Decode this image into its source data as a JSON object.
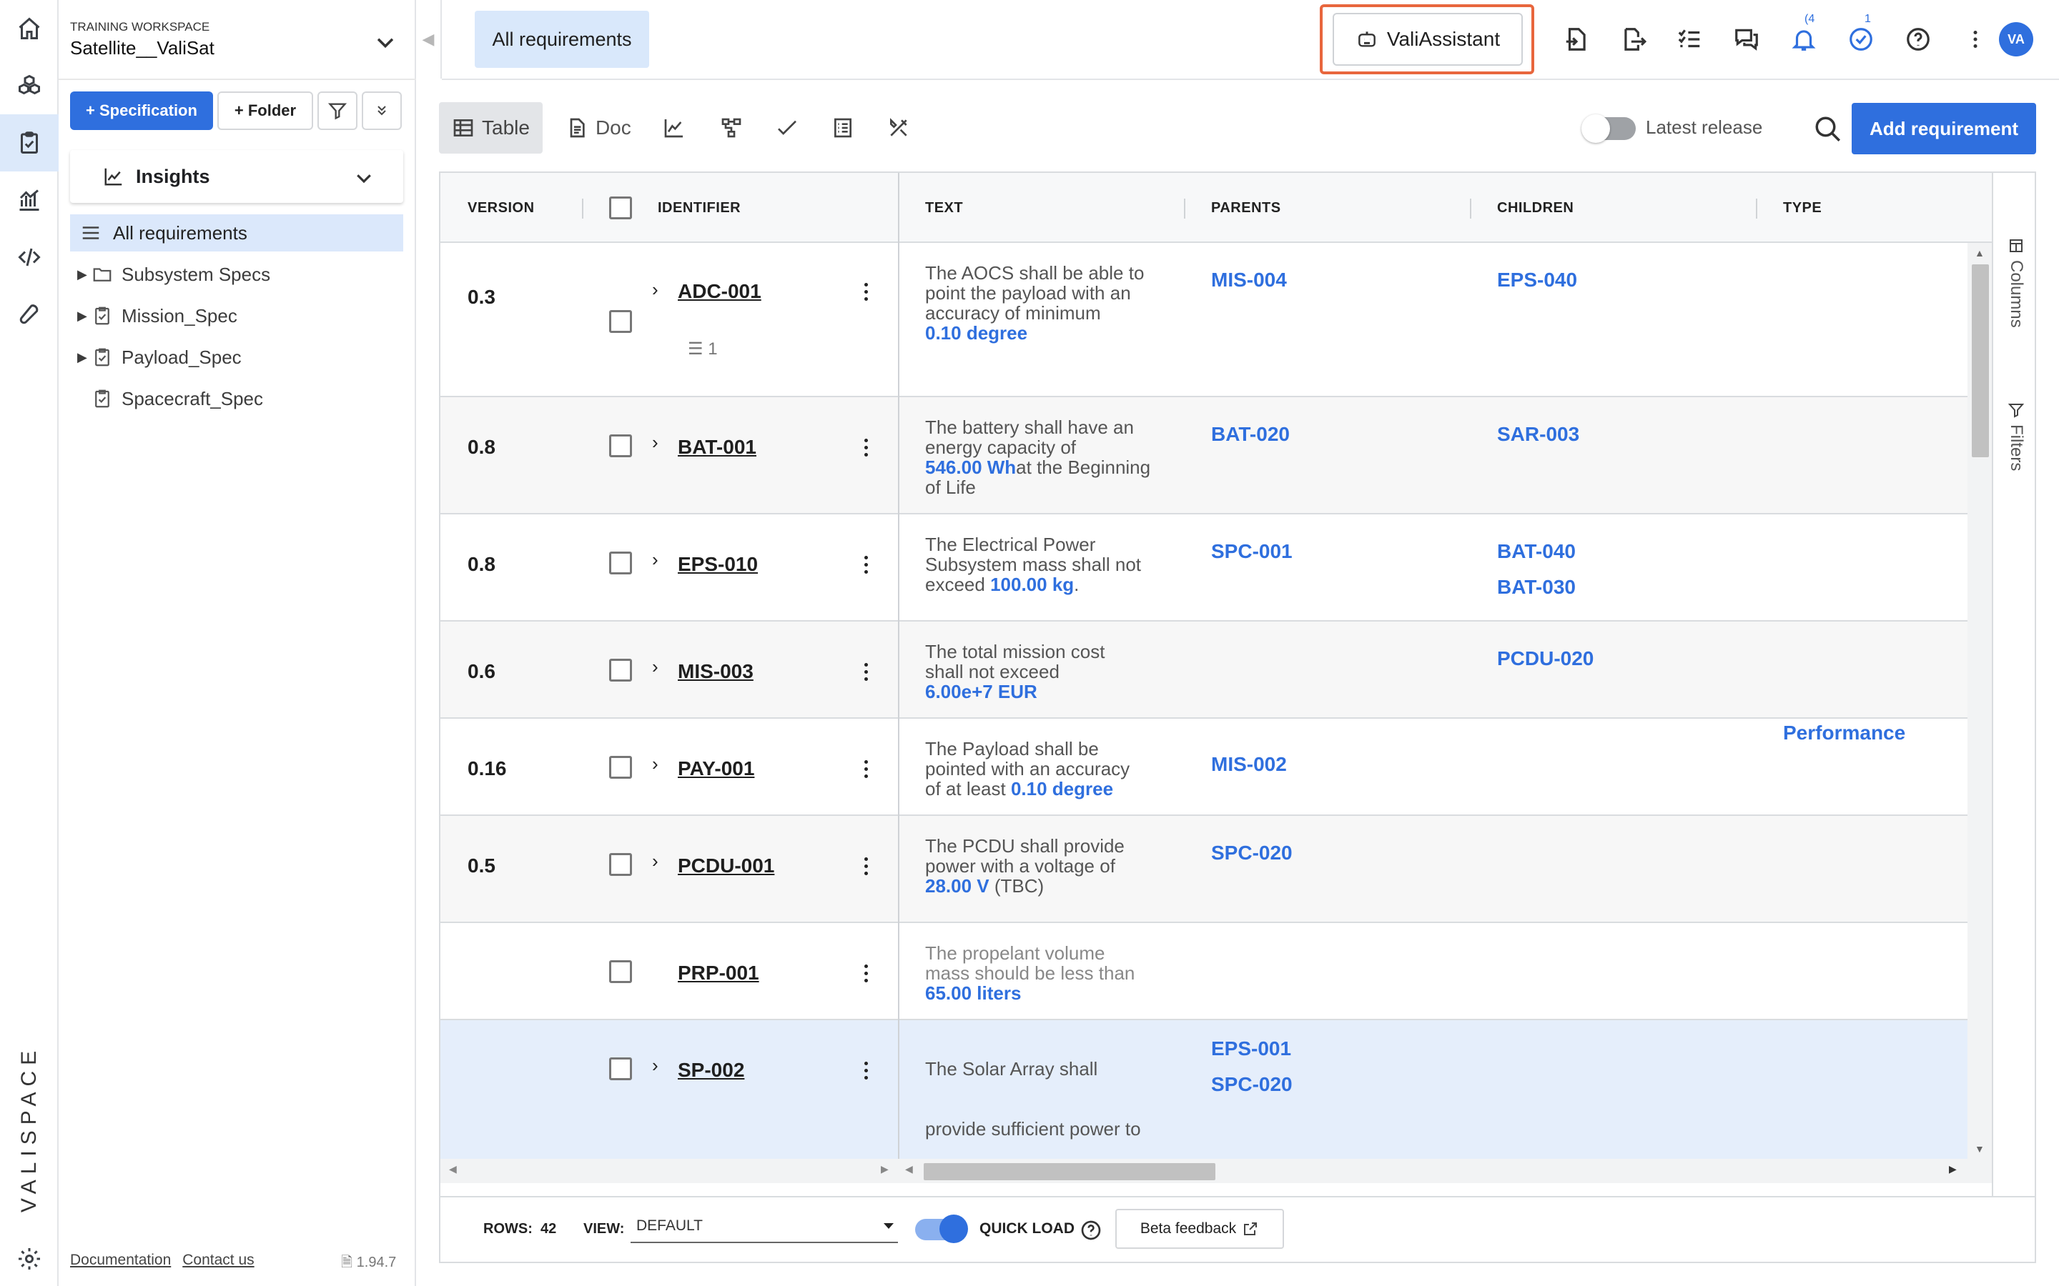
{
  "brand": {
    "accent": "#2f6fde",
    "highlight": "#e8663d",
    "logo": "VALISPACE"
  },
  "rail": {
    "icons": [
      "home-icon",
      "cubes-icon",
      "clipboard-check-icon",
      "chart-icon",
      "code-icon",
      "wrench-icon"
    ],
    "settings": "gear-icon"
  },
  "workspace": {
    "label": "TRAINING WORKSPACE",
    "name": "Satellite__ValiSat"
  },
  "sidebar": {
    "spec_button": "+ Specification",
    "folder_button": "+ Folder",
    "insights": "Insights",
    "all_requirements": "All requirements",
    "tree": [
      {
        "label": "Subsystem Specs",
        "icon": "folder-icon",
        "expandable": true
      },
      {
        "label": "Mission_Spec",
        "icon": "clipboard-icon",
        "expandable": true
      },
      {
        "label": "Payload_Spec",
        "icon": "clipboard-icon",
        "expandable": true
      },
      {
        "label": "Spacecraft_Spec",
        "icon": "clipboard-icon",
        "expandable": false
      }
    ],
    "footer": {
      "documentation": "Documentation",
      "contact": "Contact us",
      "version": "1.94.7"
    }
  },
  "header": {
    "tab": "All requirements",
    "assistant": "ValiAssistant",
    "notifications_count": "4",
    "tasks_count": "1",
    "avatar": "VA"
  },
  "toolbar": {
    "views": [
      {
        "label": "Table",
        "icon": "table-icon",
        "selected": true
      },
      {
        "label": "Doc",
        "icon": "document-icon",
        "selected": false
      },
      {
        "label": "",
        "icon": "trend-chart-icon",
        "selected": false
      },
      {
        "label": "",
        "icon": "hierarchy-icon",
        "selected": false
      },
      {
        "label": "",
        "icon": "checkmark-icon",
        "selected": false
      },
      {
        "label": "",
        "icon": "checklist-icon",
        "selected": false
      },
      {
        "label": "",
        "icon": "tools-icon",
        "selected": false
      }
    ],
    "latest_release": "Latest release",
    "add_requirement": "Add requirement"
  },
  "table": {
    "columns": [
      "VERSION",
      "IDENTIFIER",
      "TEXT",
      "PARENTS",
      "CHILDREN",
      "TYPE"
    ],
    "rows": [
      {
        "version": "0.3",
        "id": "ADC-001",
        "text": [
          "The AOCS shall be able to",
          "point the payload with an",
          "accuracy of minimum"
        ],
        "value": "0.10  degree",
        "suffix": "",
        "parents": [
          "MIS-004"
        ],
        "children": [
          "EPS-040"
        ],
        "type": "",
        "subtasks": "1"
      },
      {
        "version": "0.8",
        "id": "BAT-001",
        "text": [
          "The battery shall have an",
          "energy capacity of"
        ],
        "value": "546.00  Wh",
        "suffix": "at the Beginning of Life",
        "parents": [
          "BAT-020"
        ],
        "children": [
          "SAR-003"
        ],
        "type": ""
      },
      {
        "version": "0.8",
        "id": "EPS-010",
        "text": [
          "The Electrical Power",
          "Subsystem mass shall not",
          "exceed"
        ],
        "value": "100.00  kg",
        "suffix": ".",
        "parents": [
          "SPC-001"
        ],
        "children": [
          "BAT-040",
          "BAT-030"
        ],
        "type": ""
      },
      {
        "version": "0.6",
        "id": "MIS-003",
        "text": [
          "The total mission cost",
          "shall not exceed"
        ],
        "value": "6.00e+7  EUR",
        "suffix": "",
        "parents": [],
        "children": [
          "PCDU-020"
        ],
        "type": ""
      },
      {
        "version": "0.16",
        "id": "PAY-001",
        "text": [
          "The Payload shall be",
          "pointed with an accuracy",
          "of at least"
        ],
        "value": "0.10  degree",
        "suffix": "",
        "parents": [
          "MIS-002"
        ],
        "children": [],
        "type": "Performance"
      },
      {
        "version": "0.5",
        "id": "PCDU-001",
        "text": [
          "The PCDU shall provide",
          "power with a voltage of"
        ],
        "value": "28.00  V",
        "suffix": " (TBC)",
        "parents": [
          "SPC-020"
        ],
        "children": [],
        "type": ""
      },
      {
        "version": "",
        "id": "PRP-001",
        "text": [
          "The propelant volume",
          "mass should be less than"
        ],
        "value": "65.00  liters",
        "suffix": "",
        "parents": [],
        "children": [],
        "type": ""
      },
      {
        "version": "",
        "id": "SP-002",
        "text": [
          "The Solar Array shall",
          "",
          "provide sufficient power to"
        ],
        "value": "",
        "suffix": "",
        "parents": [
          "EPS-001",
          "SPC-020"
        ],
        "children": [],
        "type": ""
      }
    ],
    "side_panel": {
      "columns": "Columns",
      "filters": "Filters"
    }
  },
  "footer": {
    "rows_label": "ROWS:",
    "rows_value": "42",
    "view_label": "VIEW:",
    "view_value": "DEFAULT",
    "quick_load": "QUICK LOAD",
    "beta": "Beta feedback"
  }
}
